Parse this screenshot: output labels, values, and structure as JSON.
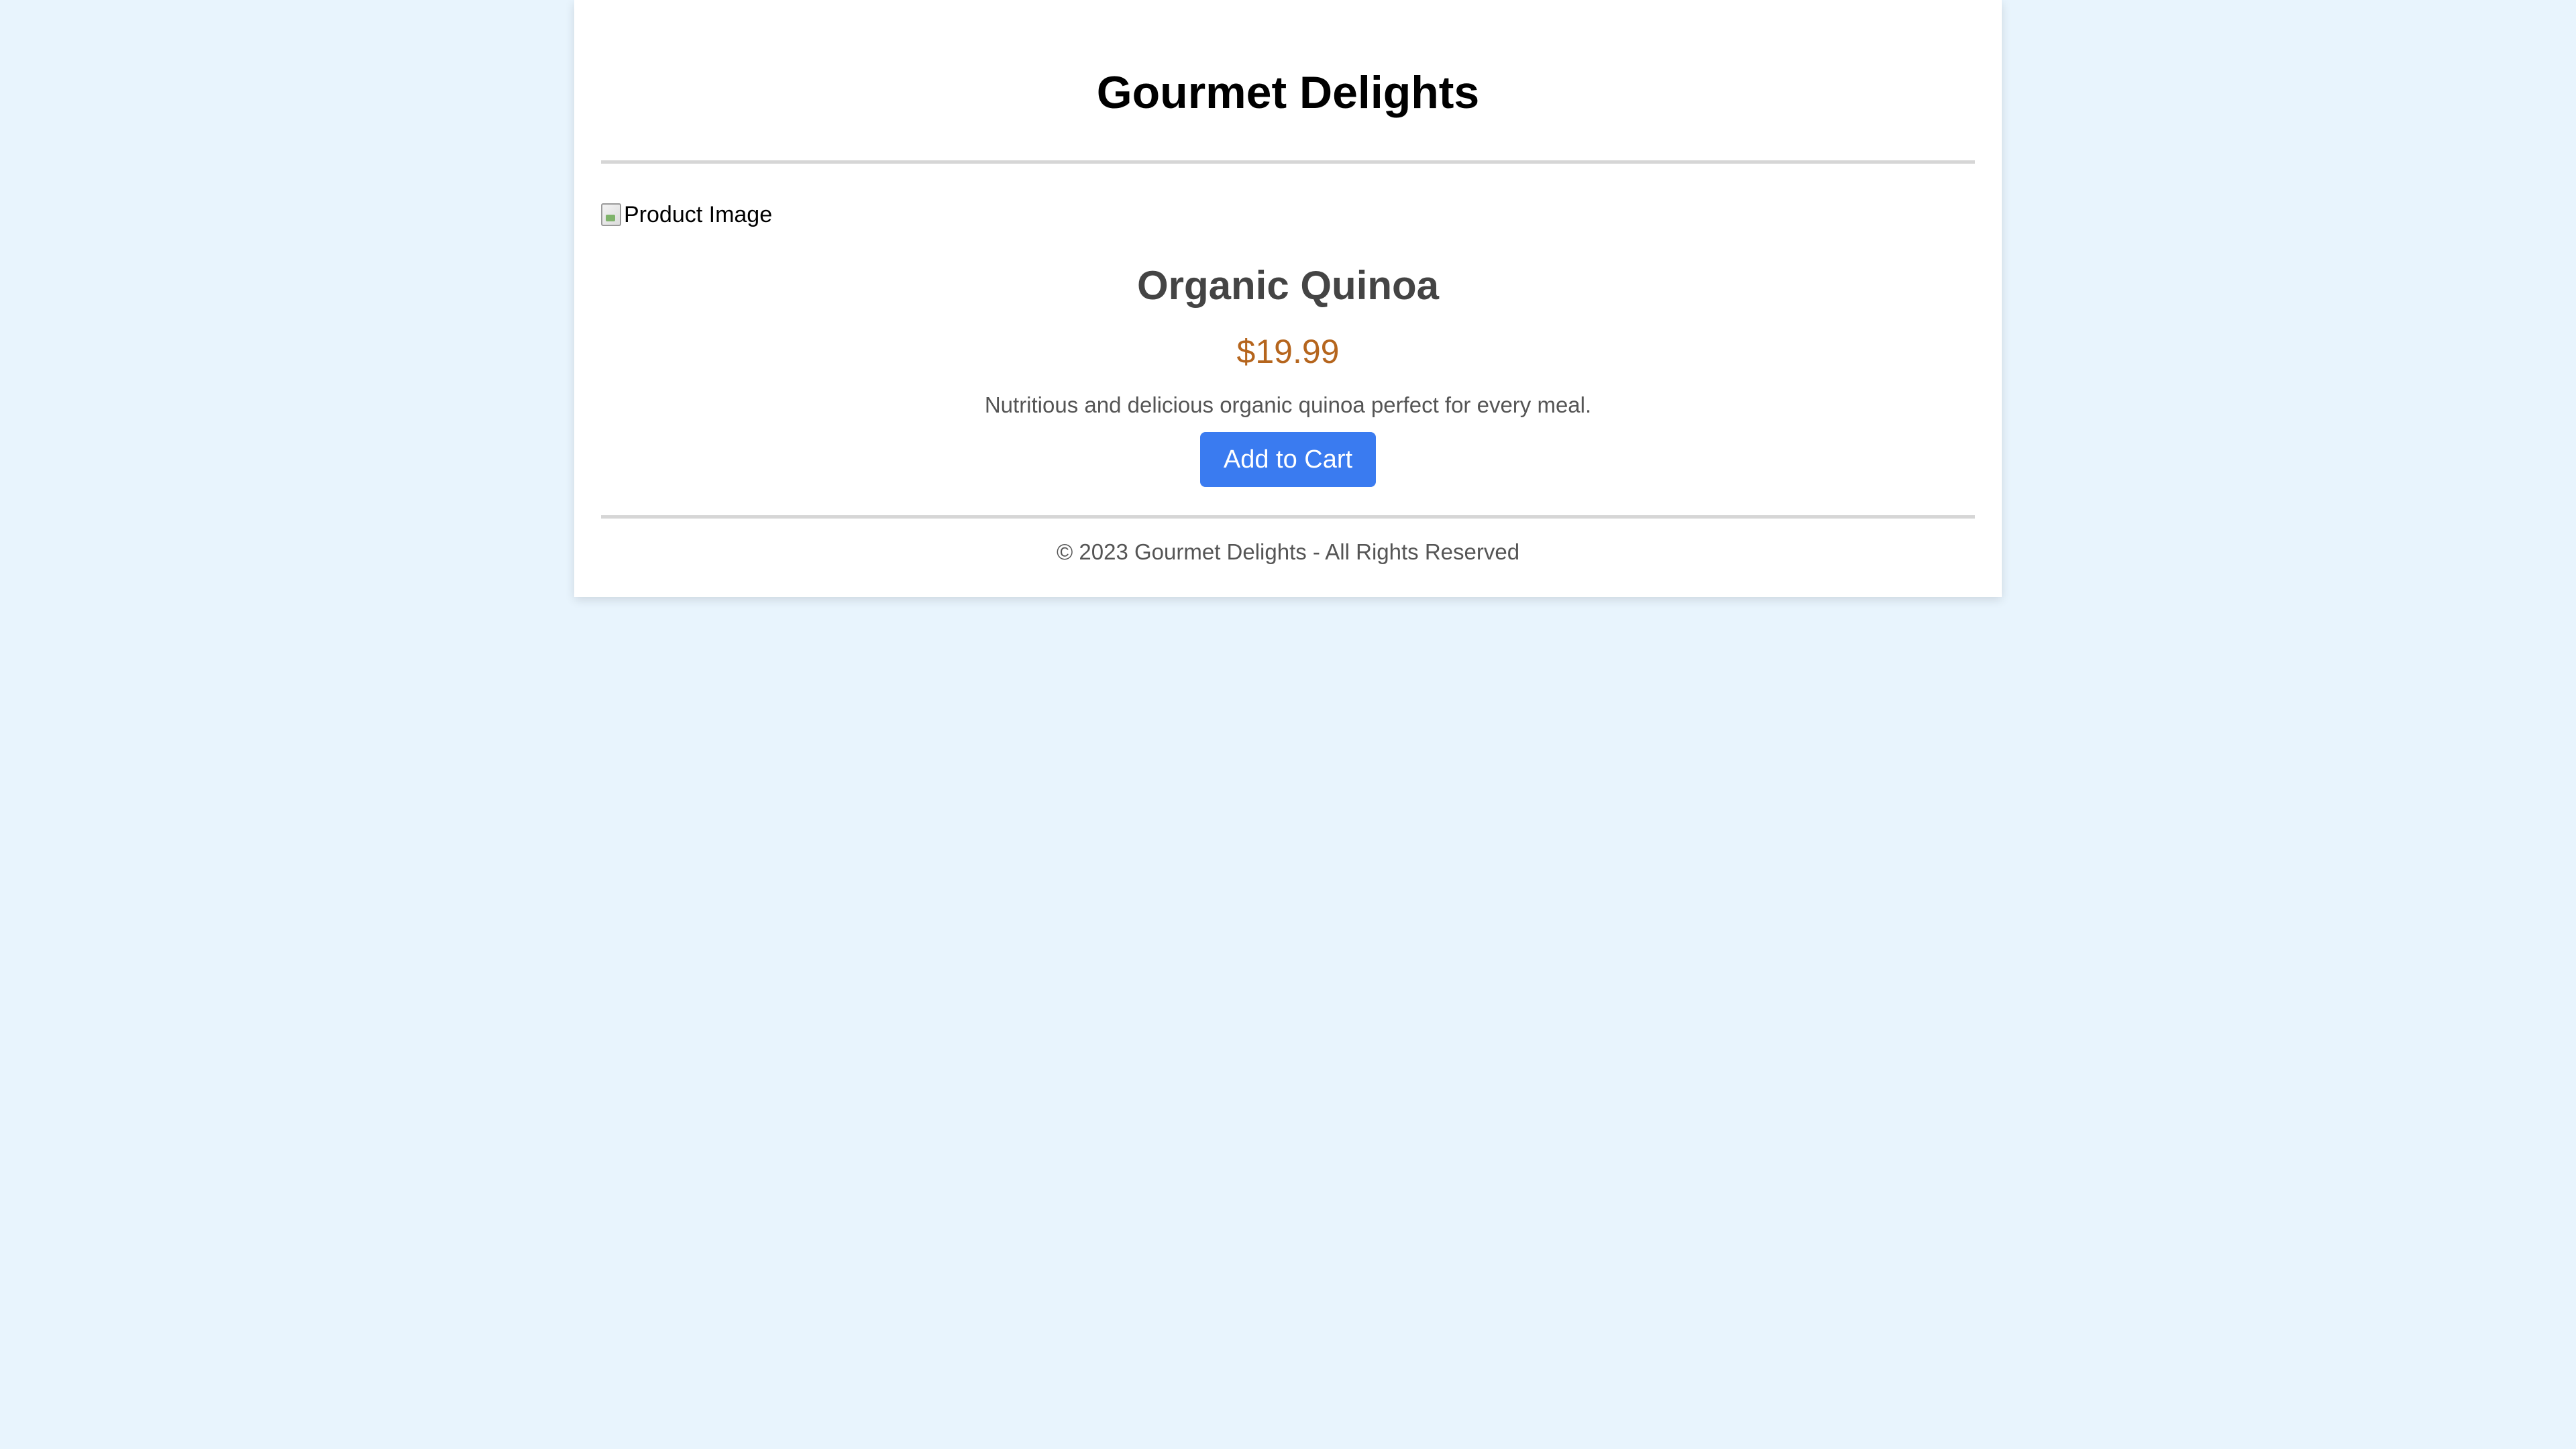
{
  "header": {
    "site_title": "Gourmet Delights"
  },
  "product": {
    "image_alt": "Product Image",
    "name": "Organic Quinoa",
    "price": "$19.99",
    "description": "Nutritious and delicious organic quinoa perfect for every meal.",
    "add_to_cart_label": "Add to Cart"
  },
  "footer": {
    "copyright": "© 2023 Gourmet Delights - All Rights Reserved"
  },
  "colors": {
    "page_background": "#e8f4fd",
    "card_background": "#ffffff",
    "price": "#b5651d",
    "button": "#3a7bf0",
    "button_text": "#ffffff",
    "heading": "#000000",
    "product_name": "#444444",
    "muted_text": "#555555"
  },
  "icons": {
    "product_image": "broken-image-icon"
  }
}
